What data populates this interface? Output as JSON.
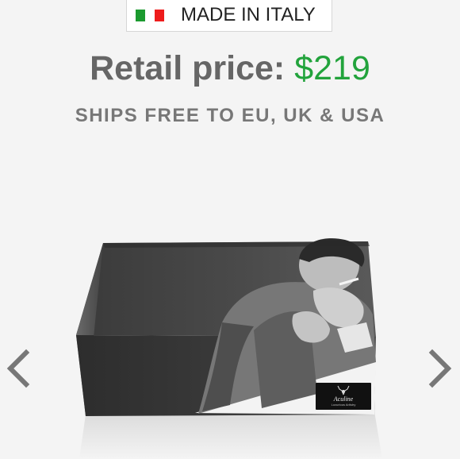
{
  "origin_badge": {
    "text": "MADE IN ITALY",
    "flag_colors": [
      "#1b9a2f",
      "#ffffff",
      "#ee1c1c"
    ]
  },
  "pricing": {
    "label": "Retail price:",
    "amount": "$219",
    "amount_color": "#22a33c"
  },
  "shipping_note": "SHIPS FREE TO EU, UK & USA",
  "carousel": {
    "prev_icon": "chevron-left-icon",
    "next_icon": "chevron-right-icon"
  },
  "product_box": {
    "logo_name": "Aculine",
    "logo_tagline": "Luxurious Artistry"
  }
}
